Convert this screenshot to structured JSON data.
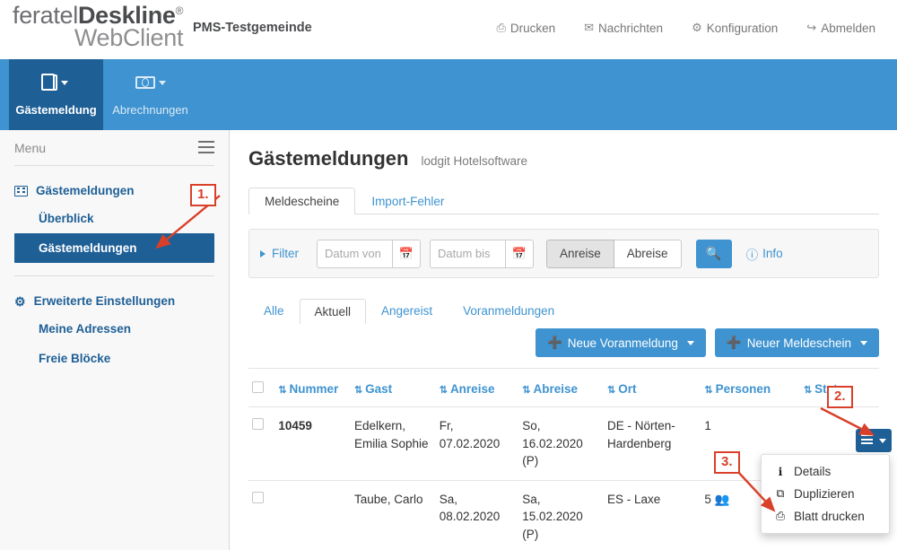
{
  "header": {
    "logo_line1": "feratelDeskline",
    "logo_brand_regular": "feratel",
    "logo_brand_bold": "Deskline",
    "logo_registered": "®",
    "logo_line2": "WebClient",
    "tenant": "PMS-Testgemeinde",
    "nav": [
      {
        "label": "Drucken",
        "icon": "printer-icon",
        "glyph": "⎙"
      },
      {
        "label": "Nachrichten",
        "icon": "envelope-icon",
        "glyph": "✉"
      },
      {
        "label": "Konfiguration",
        "icon": "gear-icon",
        "glyph": "⚙"
      },
      {
        "label": "Abmelden",
        "icon": "logout-icon",
        "glyph": "↪"
      }
    ]
  },
  "modulebar": {
    "modules": [
      {
        "label": "Gästemeldung",
        "icon": "document-icon",
        "active": true
      },
      {
        "label": "Abrechnungen",
        "icon": "money-icon",
        "active": false
      }
    ]
  },
  "sidebar": {
    "menu_label": "Menu",
    "hamburger_icon": "hamburger-icon",
    "groups": [
      {
        "title": "Gästemeldungen",
        "icon": "list-icon",
        "items": [
          {
            "label": "Überblick",
            "active": false
          },
          {
            "label": "Gästemeldungen",
            "active": true
          }
        ]
      },
      {
        "title": "Erweiterte Einstellungen",
        "icon": "gears-icon",
        "items": [
          {
            "label": "Meine Adressen",
            "active": false
          },
          {
            "label": "Freie Blöcke",
            "active": false
          }
        ]
      }
    ]
  },
  "main": {
    "page_title": "Gästemeldungen",
    "page_subtitle": "lodgit Hotelsoftware",
    "tabs": [
      {
        "label": "Meldescheine",
        "active": true
      },
      {
        "label": "Import-Fehler",
        "active": false
      }
    ],
    "filter": {
      "toggle_label": "Filter",
      "date_from_placeholder": "Datum von",
      "date_from_value": "",
      "date_to_placeholder": "Datum bis",
      "date_to_value": "",
      "calendar_icon": "calendar-icon",
      "segmented": [
        {
          "label": "Anreise",
          "selected": true
        },
        {
          "label": "Abreise",
          "selected": false
        }
      ],
      "search_icon": "search-icon",
      "info_label": "Info",
      "info_icon": "info-icon"
    },
    "subtabs": [
      {
        "label": "Alle",
        "active": false
      },
      {
        "label": "Aktuell",
        "active": true
      },
      {
        "label": "Angereist",
        "active": false
      },
      {
        "label": "Voranmeldungen",
        "active": false
      }
    ],
    "actions": [
      {
        "label": "Neue Voranmeldung",
        "icon": "plus-icon",
        "caret": true
      },
      {
        "label": "Neuer Meldeschein",
        "icon": "plus-icon",
        "caret": true
      }
    ],
    "table": {
      "columns": [
        {
          "label": "",
          "sortable": false
        },
        {
          "label": "Nummer",
          "sortable": true
        },
        {
          "label": "Gast",
          "sortable": true
        },
        {
          "label": "Anreise",
          "sortable": true
        },
        {
          "label": "Abreise",
          "sortable": true
        },
        {
          "label": "Ort",
          "sortable": true
        },
        {
          "label": "Personen",
          "sortable": true
        },
        {
          "label": "Status",
          "sortable": true
        }
      ],
      "rows": [
        {
          "nummer": "10459",
          "gast": "Edelkern, Emilia Sophie",
          "anreise_day": "Fr,",
          "anreise_date": "07.02.2020",
          "abreise_day": "So,",
          "abreise_date": "16.02.2020",
          "abreise_flag": "(P)",
          "ort": "DE - Nörten-Hardenberg",
          "personen": "1",
          "personen_group_icon": false,
          "action_icon": "menu-burger-icon"
        },
        {
          "nummer": "",
          "gast": "Taube, Carlo",
          "anreise_day": "Sa,",
          "anreise_date": "08.02.2020",
          "abreise_day": "Sa,",
          "abreise_date": "15.02.2020",
          "abreise_flag": "(P)",
          "ort": "ES - Laxe",
          "personen": "5",
          "personen_group_icon": true,
          "action_icon": "menu-burger-icon"
        }
      ]
    },
    "dropdown": {
      "items": [
        {
          "label": "Details",
          "icon": "info-icon",
          "glyph": "ℹ"
        },
        {
          "label": "Duplizieren",
          "icon": "copy-icon",
          "glyph": "⧉"
        },
        {
          "label": "Blatt drucken",
          "icon": "printer-icon",
          "glyph": "⎙"
        }
      ]
    }
  },
  "annotations": [
    {
      "label": "1."
    },
    {
      "label": "2."
    },
    {
      "label": "3."
    }
  ],
  "colors": {
    "brand_blue": "#3e93d0",
    "dark_blue": "#1e5f96",
    "annotation_red": "#d9402a",
    "date_red": "#c0392b"
  }
}
